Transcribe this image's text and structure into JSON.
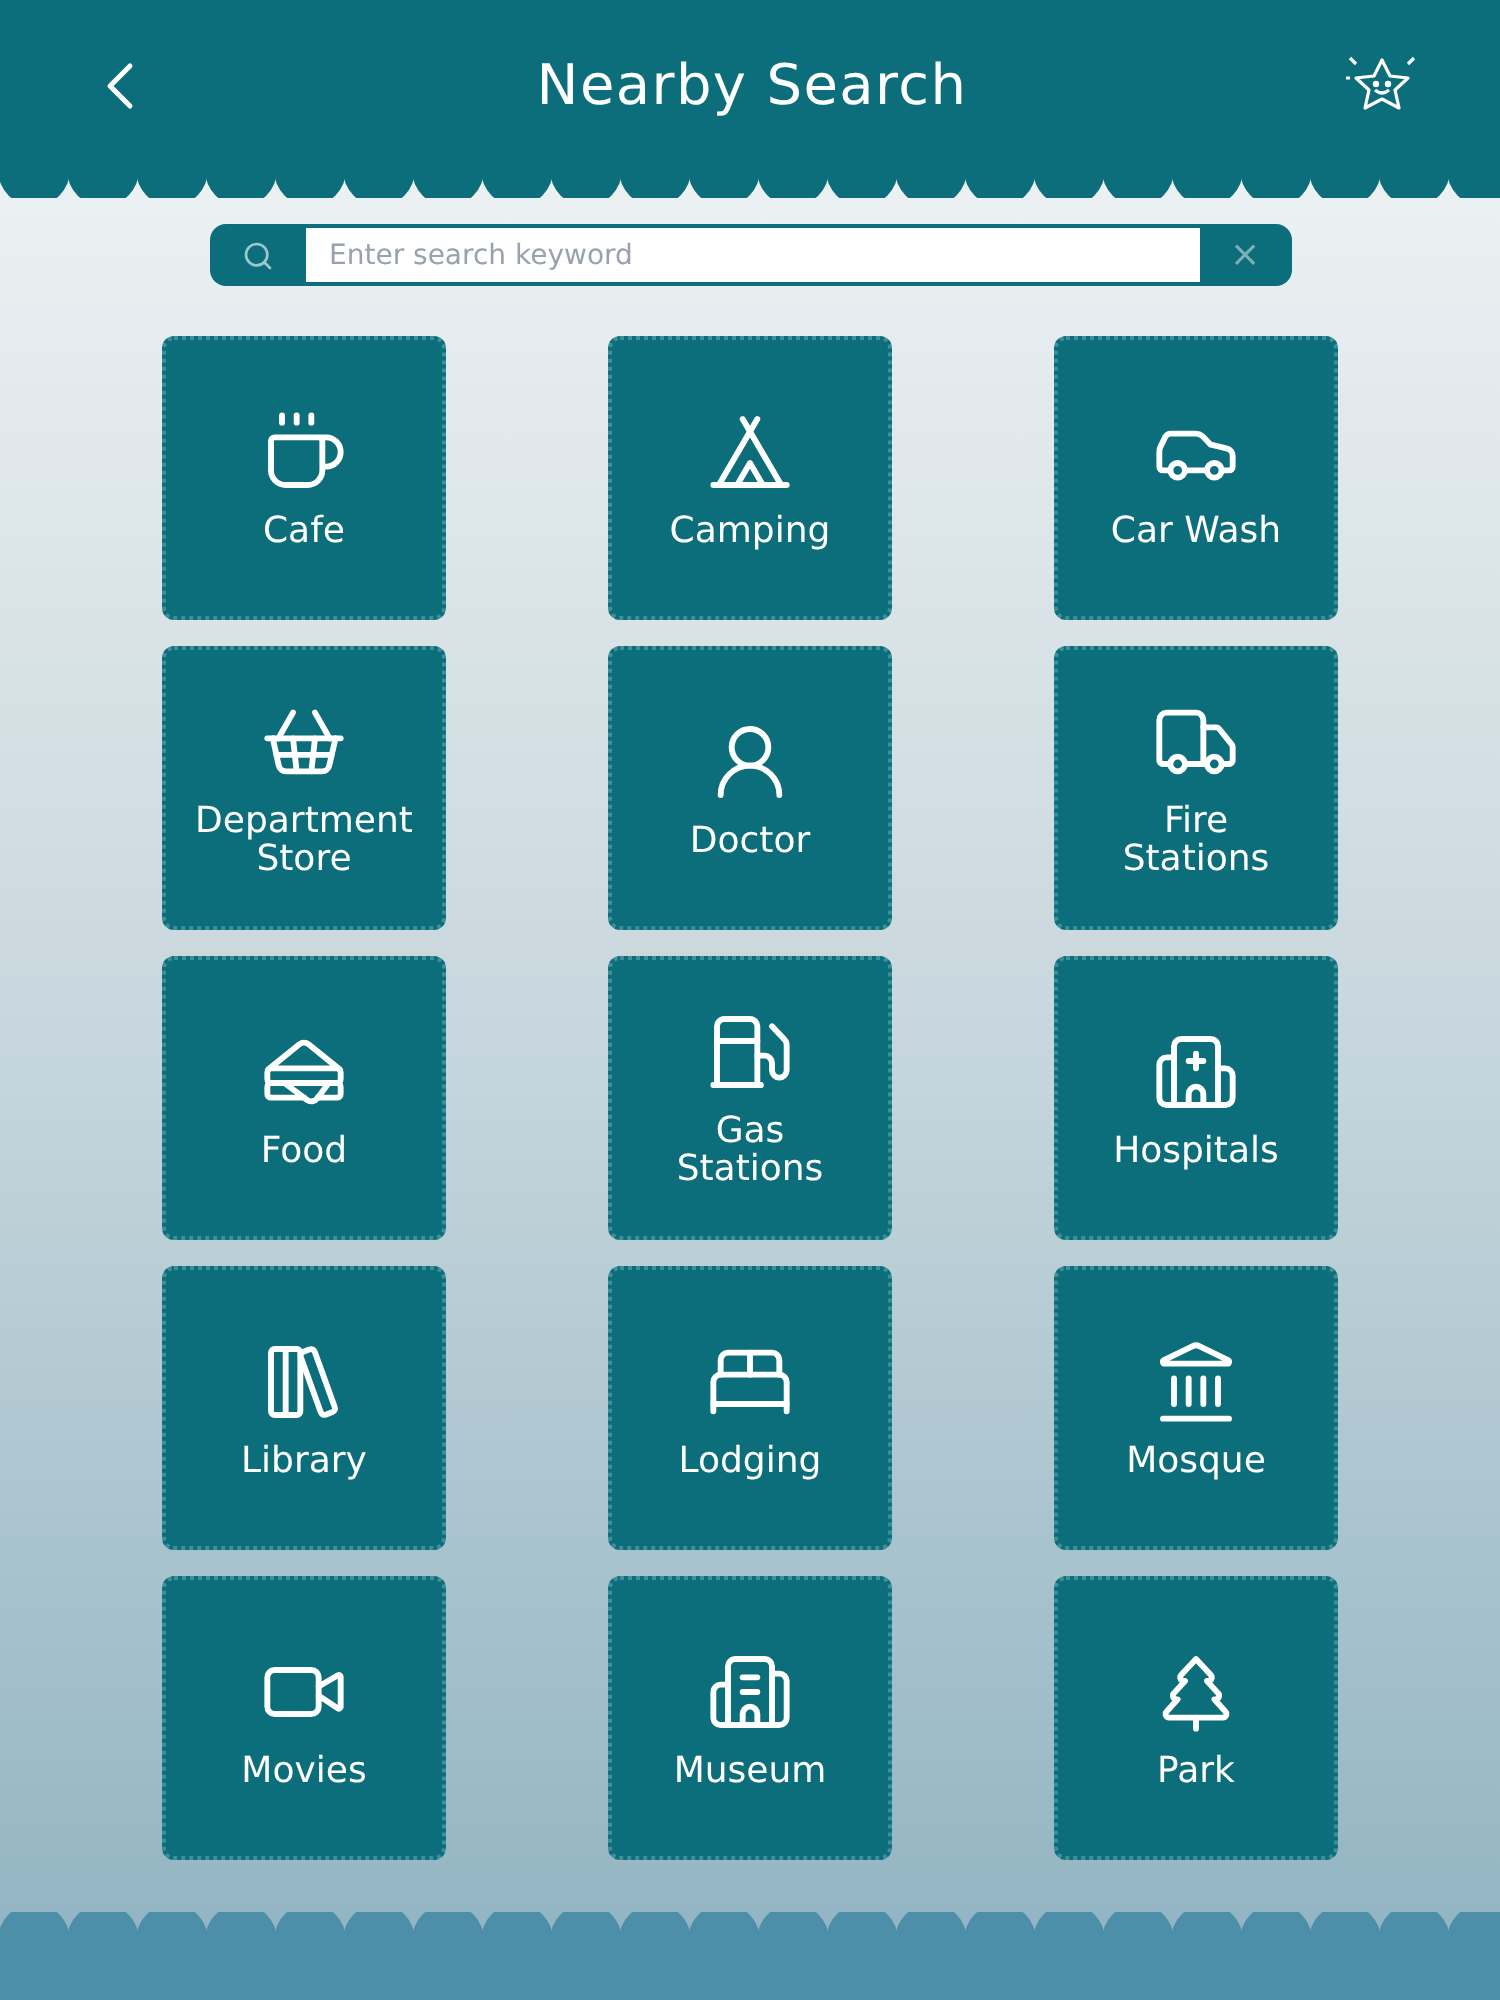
{
  "header": {
    "title": "Nearby Search"
  },
  "search": {
    "placeholder": "Enter search keyword",
    "clear_label": "×"
  },
  "categories": [
    {
      "label": "Cafe"
    },
    {
      "label": "Camping"
    },
    {
      "label": "Car Wash"
    },
    {
      "label": "Department\nStore"
    },
    {
      "label": "Doctor"
    },
    {
      "label": "Fire\nStations"
    },
    {
      "label": "Food"
    },
    {
      "label": "Gas\nStations"
    },
    {
      "label": "Hospitals"
    },
    {
      "label": "Library"
    },
    {
      "label": "Lodging"
    },
    {
      "label": "Mosque"
    },
    {
      "label": "Movies"
    },
    {
      "label": "Museum"
    },
    {
      "label": "Park"
    }
  ]
}
